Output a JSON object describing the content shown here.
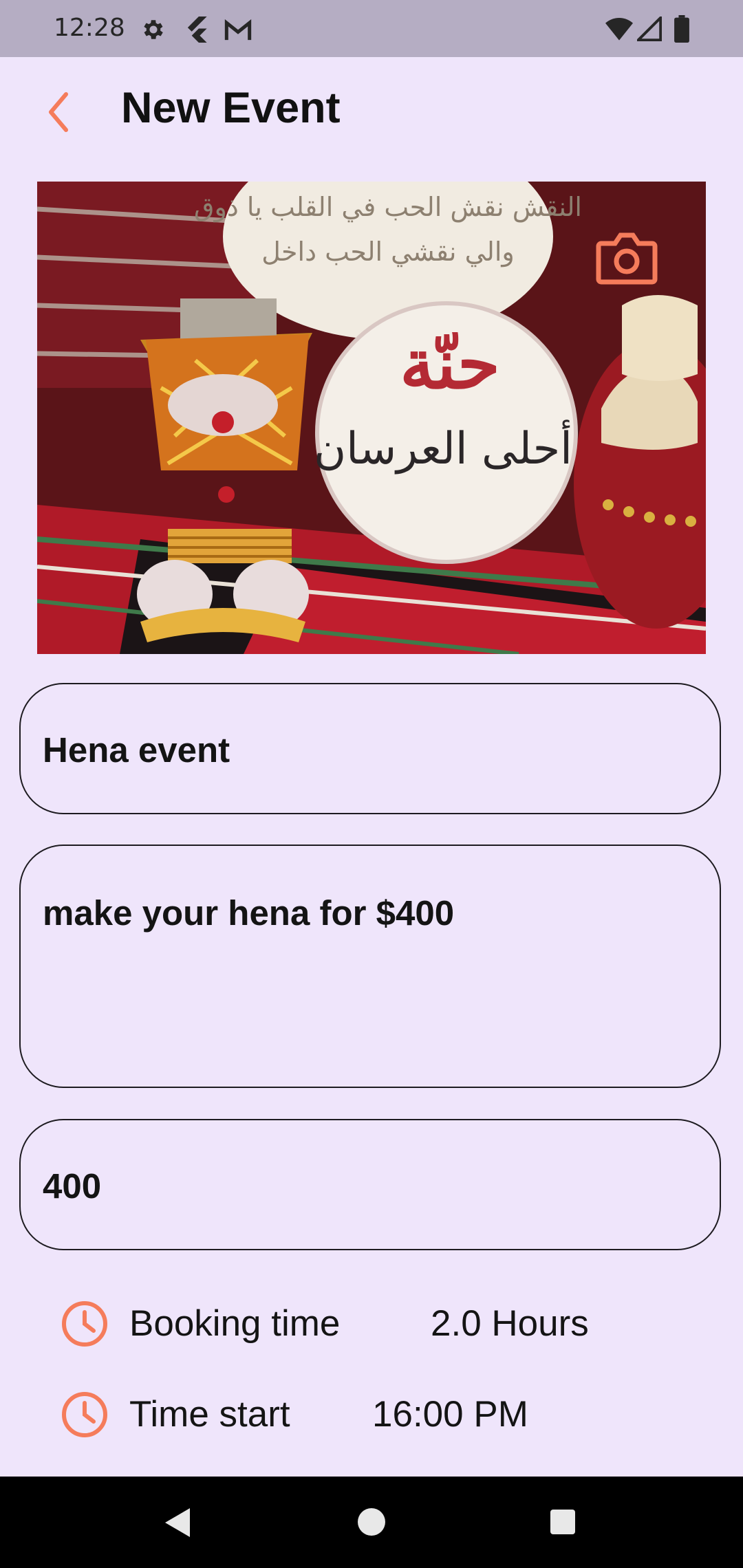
{
  "status_bar": {
    "time": "12:28",
    "left_icons": [
      "gear-icon",
      "flutter-icon",
      "gmail-icon"
    ],
    "right_icons": [
      "wifi-icon",
      "signal-icon",
      "battery-icon"
    ]
  },
  "app_bar": {
    "title": "New Event",
    "back_icon": "chevron-left-icon"
  },
  "hero_image": {
    "description_icon": "camera-icon",
    "stamp_text": "حنّة أحلى العرسان",
    "top_text_line1": "النقش نقش الحب في القلب يا ذوق",
    "top_text_line2": "والي نقشي الحب داخل"
  },
  "form": {
    "name_value": "Hena event",
    "description_value": "make your hena for $400",
    "price_value": "400"
  },
  "details": {
    "booking_label": "Booking time",
    "booking_value": "2.0 Hours",
    "start_label": "Time start",
    "start_value": "16:00 PM",
    "icon": "clock-icon"
  },
  "colors": {
    "accent": "#f57c5b",
    "background": "#efe5fb",
    "status_bar": "#b5adc3",
    "nav_bar": "#000000"
  }
}
